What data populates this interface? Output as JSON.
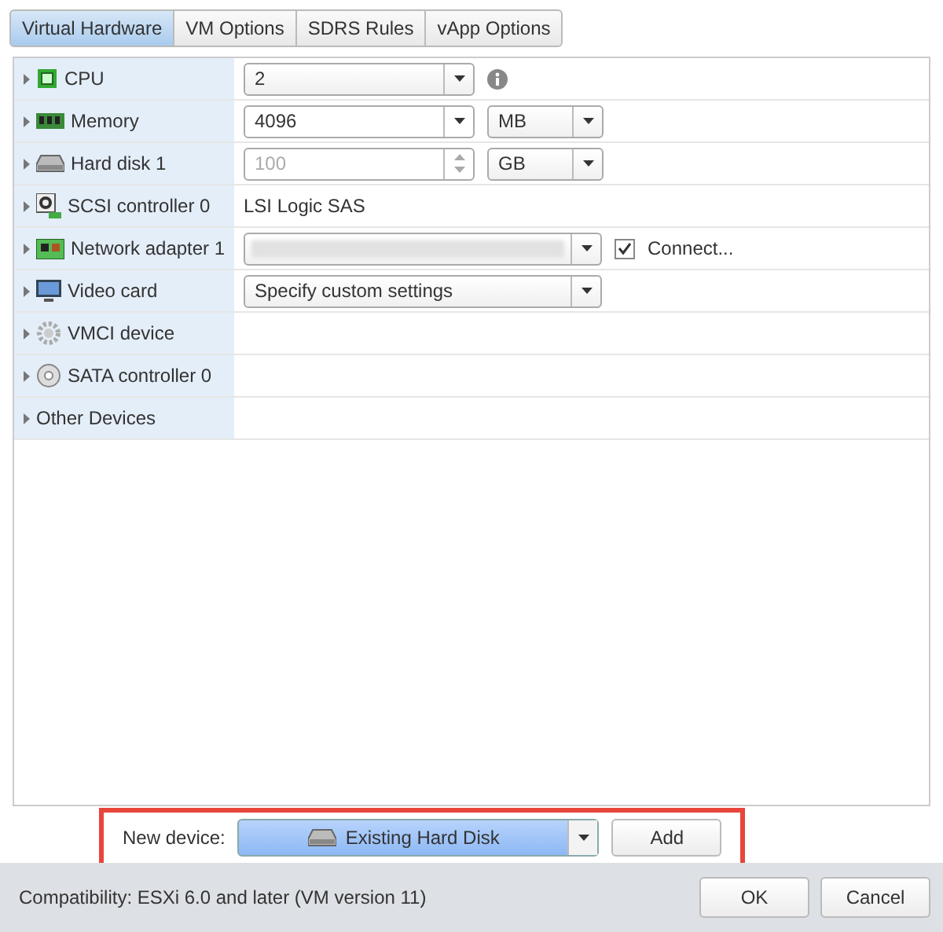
{
  "tabs": [
    {
      "label": "Virtual Hardware",
      "selected": true
    },
    {
      "label": "VM Options",
      "selected": false
    },
    {
      "label": "SDRS Rules",
      "selected": false
    },
    {
      "label": "vApp Options",
      "selected": false
    }
  ],
  "devices": [
    {
      "name": "CPU",
      "kind": "select",
      "value": "2",
      "info": true
    },
    {
      "name": "Memory",
      "kind": "input_unit",
      "value": "4096",
      "unit": "MB"
    },
    {
      "name": "Hard disk 1",
      "kind": "spinner_unit",
      "value": "100",
      "unit": "GB",
      "disabled": true
    },
    {
      "name": "SCSI controller 0",
      "kind": "text",
      "value": "LSI Logic SAS"
    },
    {
      "name": "Network adapter 1",
      "kind": "redacted_check",
      "check_label": "Connect...",
      "checked": true
    },
    {
      "name": "Video card",
      "kind": "wide_select",
      "value": "Specify custom settings"
    },
    {
      "name": "VMCI device",
      "kind": "empty"
    },
    {
      "name": "SATA controller 0",
      "kind": "empty"
    },
    {
      "name": "Other Devices",
      "kind": "empty"
    }
  ],
  "new_device": {
    "label": "New device:",
    "value": "Existing Hard Disk",
    "button": "Add"
  },
  "compatibility": "Compatibility: ESXi 6.0 and later (VM version 11)",
  "buttons": [
    "OK",
    "Cancel"
  ]
}
